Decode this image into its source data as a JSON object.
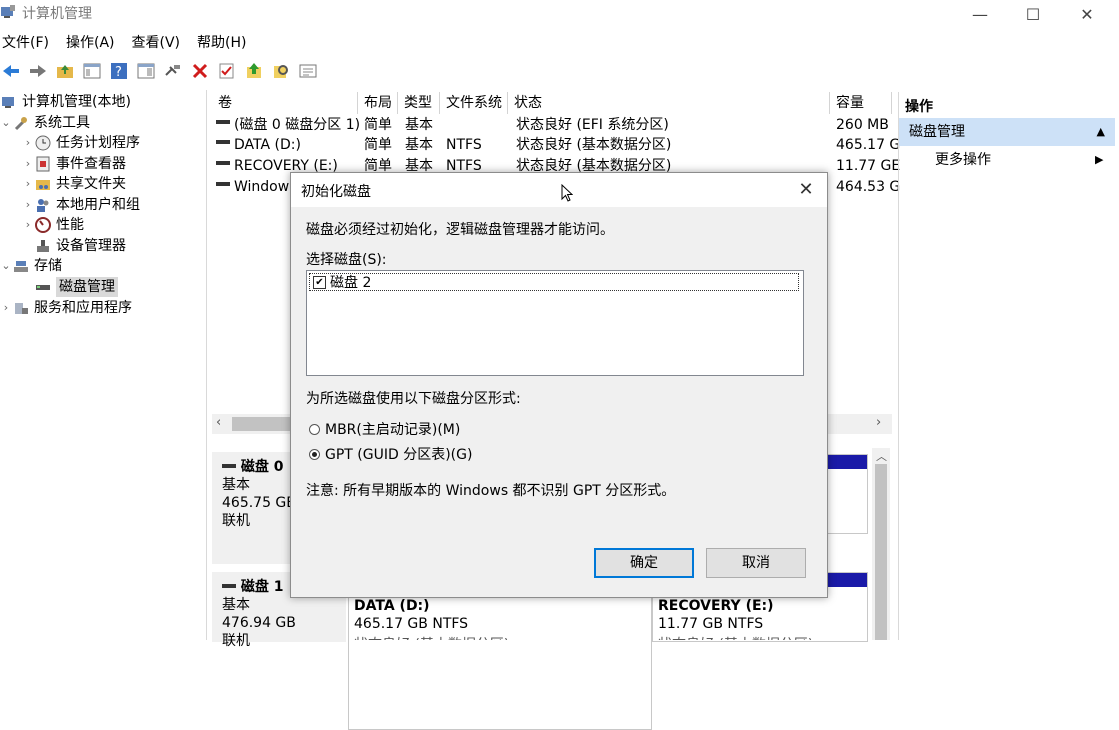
{
  "window": {
    "title": "计算机管理",
    "minimize": "—",
    "maximize": "☐",
    "close": "✕"
  },
  "menu": [
    "文件(F)",
    "操作(A)",
    "查看(V)",
    "帮助(H)"
  ],
  "tree": {
    "items": [
      {
        "label": "计算机管理(本地)",
        "expander": ""
      },
      {
        "label": "系统工具",
        "expander": "⌄"
      },
      {
        "label": "任务计划程序",
        "expander": "›"
      },
      {
        "label": "事件查看器",
        "expander": "›"
      },
      {
        "label": "共享文件夹",
        "expander": "›"
      },
      {
        "label": "本地用户和组",
        "expander": "›"
      },
      {
        "label": "性能",
        "expander": "›"
      },
      {
        "label": "设备管理器",
        "expander": ""
      },
      {
        "label": "存储",
        "expander": "⌄"
      },
      {
        "label": "磁盘管理",
        "expander": ""
      },
      {
        "label": "服务和应用程序",
        "expander": "›"
      }
    ]
  },
  "volumes": {
    "headers": [
      "卷",
      "布局",
      "类型",
      "文件系统",
      "状态",
      "容量"
    ],
    "rows": [
      [
        "(磁盘 0 磁盘分区 1)",
        "简单",
        "基本",
        "",
        "状态良好 (EFI 系统分区)",
        "260 MB"
      ],
      [
        "DATA (D:)",
        "简单",
        "基本",
        "NTFS",
        "状态良好 (基本数据分区)",
        "465.17 G"
      ],
      [
        "RECOVERY (E:)",
        "简单",
        "基本",
        "NTFS",
        "状态良好 (基本数据分区)",
        "11.77 GE"
      ],
      [
        "Windows",
        "",
        "",
        "",
        "",
        "464.53 G"
      ]
    ]
  },
  "disks": [
    {
      "name": "磁盘 0",
      "type": "基本",
      "size": "465.75 GB",
      "status": "联机"
    },
    {
      "name": "磁盘 1",
      "type": "基本",
      "size": "476.94 GB",
      "status": "联机"
    }
  ],
  "partitions": [
    {
      "name": "DATA  (D:)",
      "fs": "465.17 GB NTFS",
      "status": "状态良好 (基本数据分区)"
    },
    {
      "name": "RECOVERY  (E:)",
      "fs": "11.77 GB NTFS",
      "status": "状态良好 (基本数据分区)"
    }
  ],
  "actions": {
    "header": "操作",
    "section": "磁盘管理",
    "more": "更多操作"
  },
  "dialog": {
    "title": "初始化磁盘",
    "message": "磁盘必须经过初始化，逻辑磁盘管理器才能访问。",
    "select_label": "选择磁盘(S):",
    "disk_item": "磁盘 2",
    "style_label": "为所选磁盘使用以下磁盘分区形式:",
    "option_mbr": "MBR(主启动记录)(M)",
    "option_gpt": "GPT (GUID 分区表)(G)",
    "selected_option": "GPT",
    "note": "注意: 所有早期版本的 Windows 都不识别 GPT 分区形式。",
    "ok": "确定",
    "cancel": "取消"
  },
  "colors": {
    "selection": "#cde1f7",
    "partition_bar": "#1a1aa8",
    "focus": "#0078d7"
  }
}
